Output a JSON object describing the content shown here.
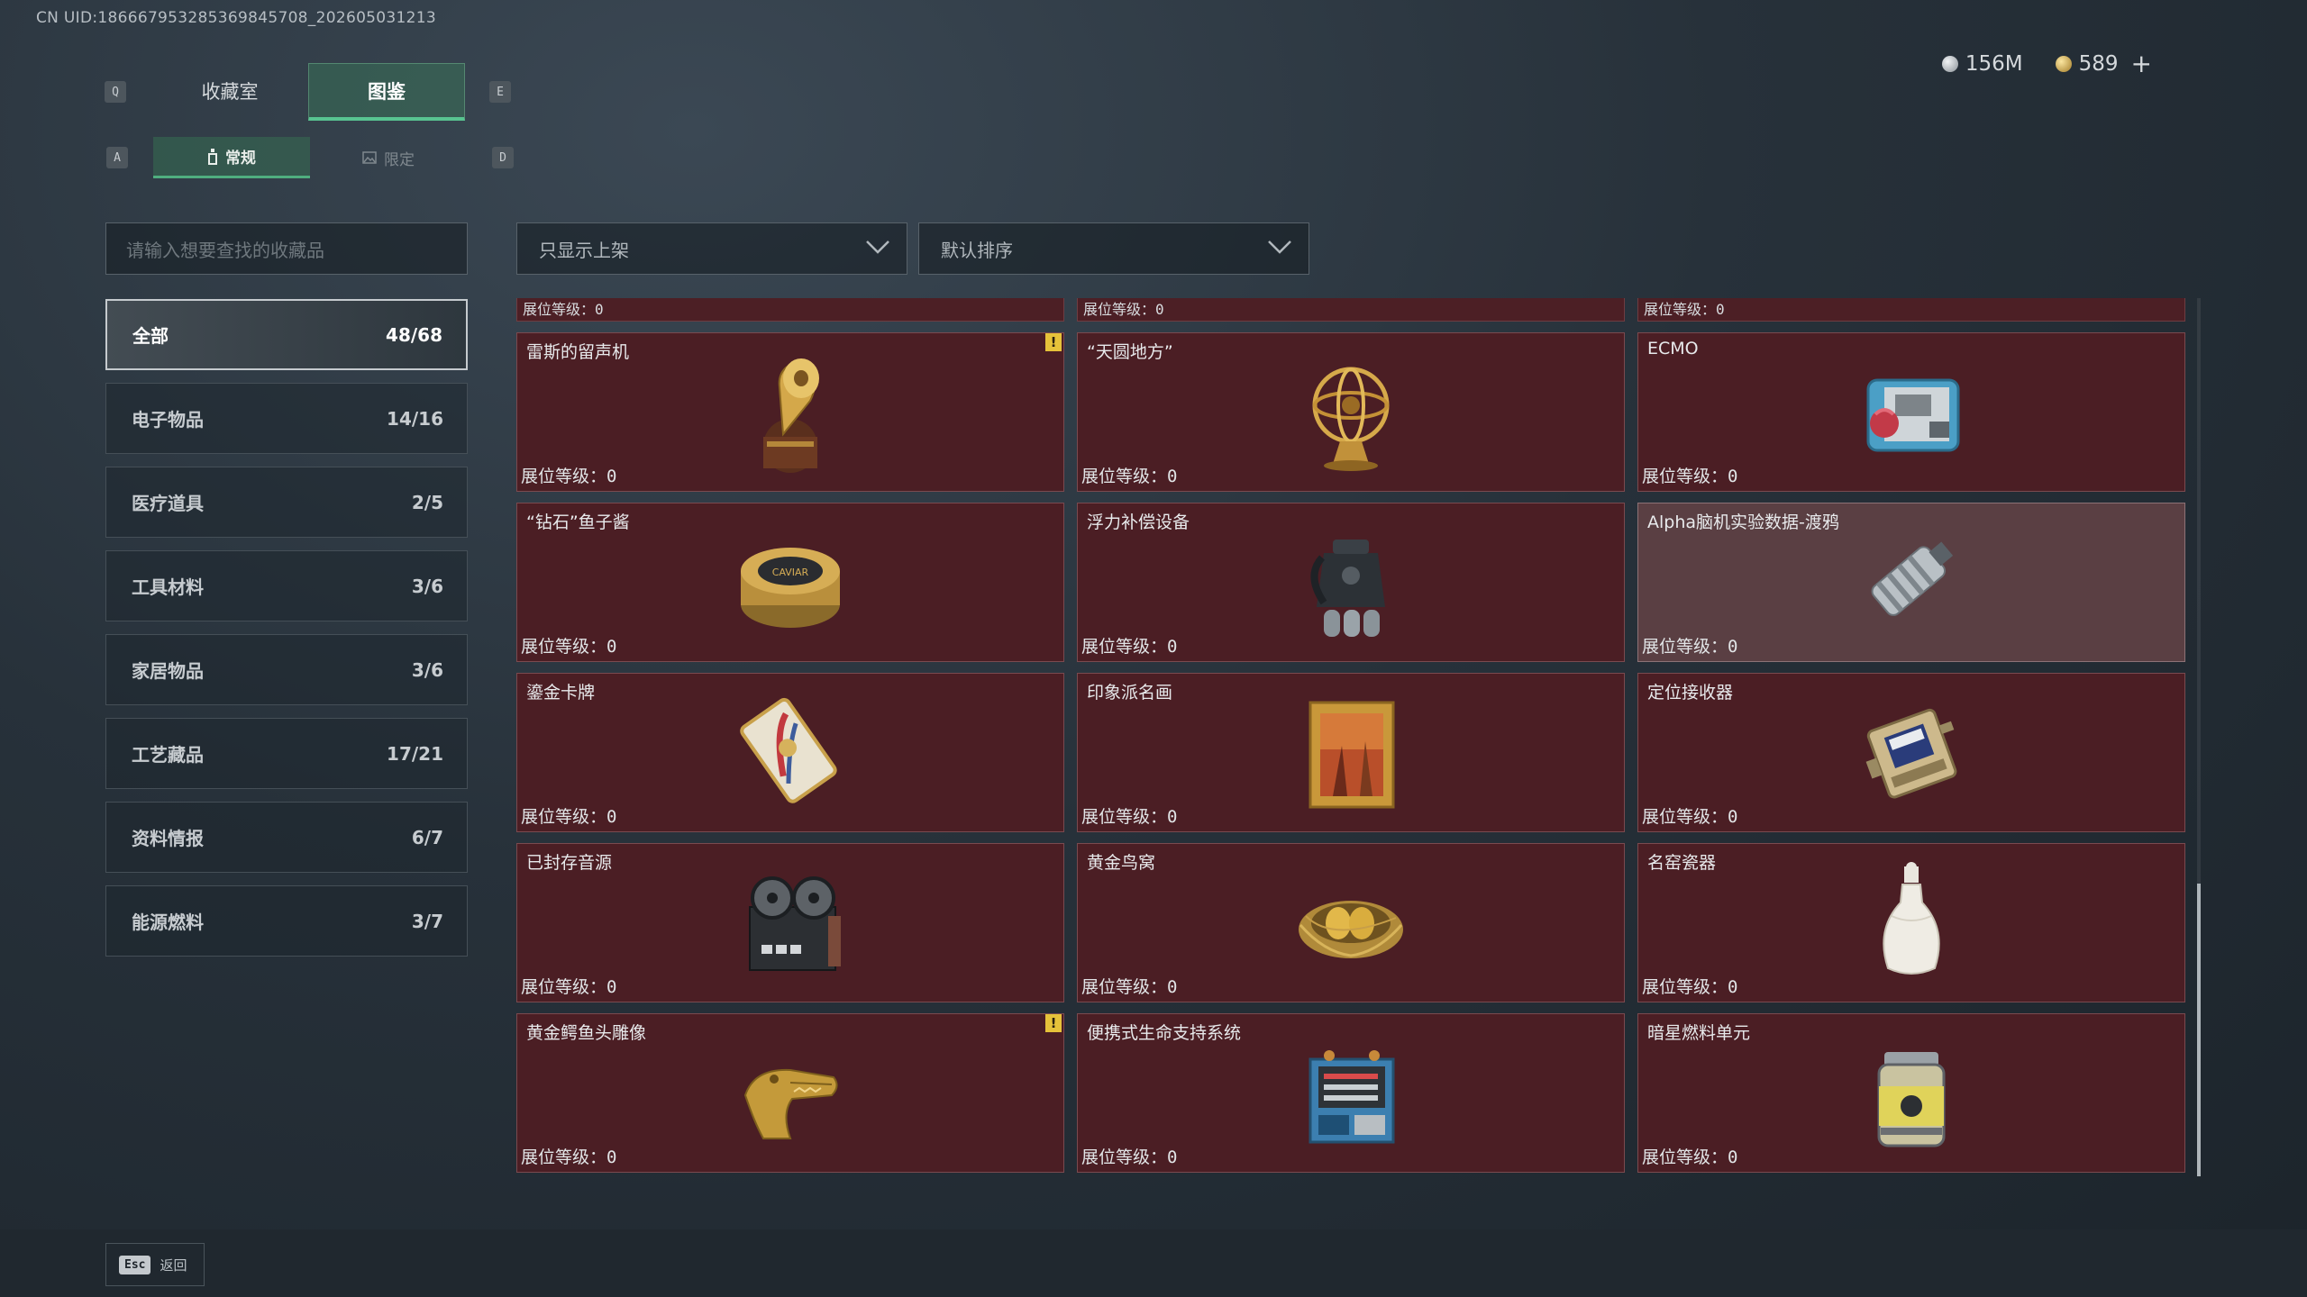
{
  "uid": "CN UID:18666795328536984570​8_202605031213",
  "currency": {
    "silver": "156M",
    "gold": "589",
    "plus": "+"
  },
  "keys": {
    "prev_tab": "Q",
    "next_tab": "E",
    "prev_sub": "A",
    "next_sub": "D"
  },
  "tabs": [
    {
      "label": "收藏室",
      "active": false
    },
    {
      "label": "图鉴",
      "active": true
    }
  ],
  "subtabs": [
    {
      "label": "常规",
      "active": true
    },
    {
      "label": "限定",
      "active": false
    }
  ],
  "search": {
    "placeholder": "请输入想要查找的收藏品"
  },
  "filters": {
    "shelf": "只显示上架",
    "sort": "默认排序"
  },
  "categories": [
    {
      "label": "全部",
      "count": "48/68",
      "active": true
    },
    {
      "label": "电子物品",
      "count": "14/16"
    },
    {
      "label": "医疗道具",
      "count": "2/5"
    },
    {
      "label": "工具材料",
      "count": "3/6"
    },
    {
      "label": "家居物品",
      "count": "3/6"
    },
    {
      "label": "工艺藏品",
      "count": "17/21"
    },
    {
      "label": "资料情报",
      "count": "6/7"
    },
    {
      "label": "能源燃料",
      "count": "3/7"
    }
  ],
  "level_label": "展位等级：",
  "level_value": "0",
  "partial_row_count": 3,
  "items": [
    {
      "name": "雷斯的留声机",
      "icon": "gramophone",
      "warning": true
    },
    {
      "name": "“天圆地方”",
      "icon": "armillary-sphere",
      "warning": false
    },
    {
      "name": "ECMO",
      "icon": "ecmo-machine",
      "warning": false
    },
    {
      "name": "“钻石”鱼子酱",
      "icon": "caviar-tin",
      "warning": false
    },
    {
      "name": "浮力补偿设备",
      "icon": "buoyancy-device",
      "warning": false
    },
    {
      "name": "Alpha脑机实验数据-渡鸦",
      "icon": "data-canister",
      "warning": false,
      "highlight": true
    },
    {
      "name": "鎏金卡牌",
      "icon": "gilded-card",
      "warning": false
    },
    {
      "name": "印象派名画",
      "icon": "framed-painting",
      "warning": false
    },
    {
      "name": "定位接收器",
      "icon": "locator-receiver",
      "warning": false
    },
    {
      "name": "已封存音源",
      "icon": "tape-recorder",
      "warning": false
    },
    {
      "name": "黄金鸟窝",
      "icon": "golden-nest",
      "warning": false
    },
    {
      "name": "名窑瓷器",
      "icon": "porcelain-vase",
      "warning": false
    },
    {
      "name": "黄金鳄鱼头雕像",
      "icon": "crocodile-statue",
      "warning": true
    },
    {
      "name": "便携式生命支持系统",
      "icon": "life-support",
      "warning": false
    },
    {
      "name": "暗星燃料单元",
      "icon": "fuel-cell",
      "warning": false
    }
  ],
  "warning_mark": "!",
  "footer": {
    "esc_key": "Esc",
    "back_label": "返回"
  },
  "colors": {
    "card_bg": "#4b1e24",
    "accent_green": "#58c491",
    "warning": "#e6c23a"
  }
}
